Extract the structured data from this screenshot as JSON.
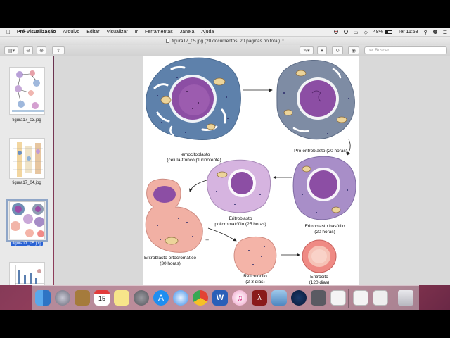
{
  "menubar": {
    "app_name": "Pré-Visualização",
    "menus": [
      "Arquivo",
      "Editar",
      "Visualizar",
      "Ir",
      "Ferramentas",
      "Janela",
      "Ajuda"
    ],
    "battery": "48%",
    "clock": "Ter 11:58"
  },
  "window": {
    "title": "figura17_05.jpg (20 documentos, 20 páginas no total)"
  },
  "toolbar": {
    "search_placeholder": "Buscar"
  },
  "sidebar": {
    "items": [
      {
        "label": "figura17_03.jpg",
        "selected": false
      },
      {
        "label": "figura17_04.jpg",
        "selected": false
      },
      {
        "label": "figura17_05.jpg",
        "selected": true
      },
      {
        "label": "",
        "selected": false
      }
    ]
  },
  "figure": {
    "labels": {
      "hemocitoblasto": [
        "Hemocitoblasto",
        "(célula-tronco pluripotente)"
      ],
      "pro_eritroblasto": [
        "Pró-eritroblasto (20 horas)"
      ],
      "eritroblasto_basofilo": [
        "Eritroblasto basófilo",
        "(20 horas)"
      ],
      "eritroblasto_policromatofilo": [
        "Eritroblasto",
        "policromatófilo (25 horas)"
      ],
      "eritroblasto_ortocromatico": [
        "Eritroblasto ortocromático",
        "(30 horas)"
      ],
      "reticulocito": [
        "Reticulócito",
        "(2-3 dias)"
      ],
      "eritrocito": [
        "Eritrócito",
        "(120 dias)"
      ]
    }
  },
  "dock": {
    "apps": [
      "finder",
      "launchpad",
      "notes-box",
      "calendar",
      "stickies",
      "system-preferences",
      "app-store",
      "safari",
      "chrome",
      "word",
      "itunes",
      "acrobat",
      "preview",
      "quicktime",
      "screenshot",
      "document-1",
      "document-2",
      "document-3",
      "trash"
    ],
    "calendar_day": "15"
  },
  "colors": {
    "selection": "#2962d4",
    "accent_blue": "#1f6fe0"
  }
}
